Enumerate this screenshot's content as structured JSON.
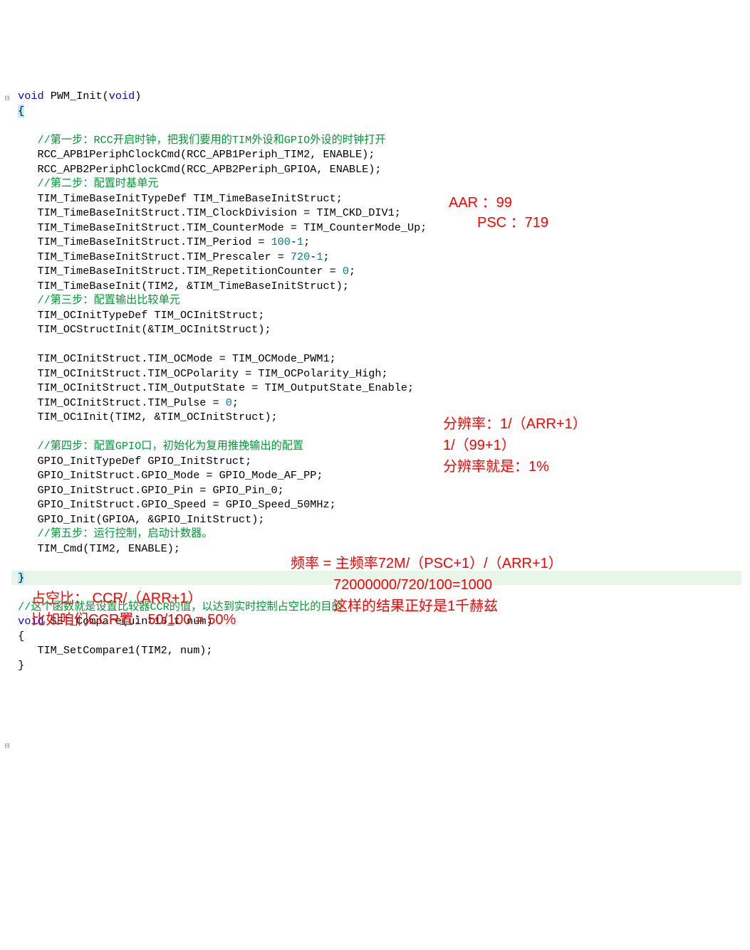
{
  "code": {
    "blank0": " ",
    "sig_void1": "void",
    "sig_fn": " PWM_Init(",
    "sig_void2": "void",
    "sig_close": ")",
    "brace_open": "{",
    "cm1": "//第一步：RCC开启时钟，把我们要用的TIM外设和GPIO外设的时钟打开",
    "line_rcc1": "    RCC_APB1PeriphClockCmd(RCC_APB1Periph_TIM2, ENABLE);",
    "line_rcc2": "    RCC_APB2PeriphClockCmd(RCC_APB2Periph_GPIOA, ENABLE);",
    "cm2": "//第二步：配置时基单元",
    "line_tb1": "    TIM_TimeBaseInitTypeDef TIM_TimeBaseInitStruct;",
    "line_tb2": "    TIM_TimeBaseInitStruct.TIM_ClockDivision = TIM_CKD_DIV1;",
    "line_tb3": "    TIM_TimeBaseInitStruct.TIM_CounterMode = TIM_CounterMode_Up;",
    "line_tb4a": "    TIM_TimeBaseInitStruct.TIM_Period = ",
    "line_tb4n1": "100",
    "line_tb4mid": "-",
    "line_tb4n2": "1",
    "line_tb4b": ";",
    "line_tb5a": "    TIM_TimeBaseInitStruct.TIM_Prescaler = ",
    "line_tb5n1": "720",
    "line_tb5mid": "-",
    "line_tb5n2": "1",
    "line_tb5b": ";",
    "line_tb6a": "    TIM_TimeBaseInitStruct.TIM_RepetitionCounter = ",
    "line_tb6n": "0",
    "line_tb6b": ";",
    "line_tb7": "    TIM_TimeBaseInit(TIM2, &TIM_TimeBaseInitStruct);",
    "cm3": "//第三步：配置输出比较单元",
    "line_oc1": "    TIM_OCInitTypeDef TIM_OCInitStruct;",
    "line_oc2": "    TIM_OCStructInit(&TIM_OCInitStruct);",
    "blank1": "    ",
    "line_oc3": "    TIM_OCInitStruct.TIM_OCMode = TIM_OCMode_PWM1;",
    "line_oc4": "    TIM_OCInitStruct.TIM_OCPolarity = TIM_OCPolarity_High;",
    "line_oc5": "    TIM_OCInitStruct.TIM_OutputState = TIM_OutputState_Enable;",
    "line_oc6a": "    TIM_OCInitStruct.TIM_Pulse = ",
    "line_oc6n": "0",
    "line_oc6b": ";",
    "line_oc7": "    TIM_OC1Init(TIM2, &TIM_OCInitStruct);",
    "blank2": "    ",
    "cm4": "//第四步：配置GPIO口，初始化为复用推挽输出的配置",
    "line_g1": "    GPIO_InitTypeDef GPIO_InitStruct;",
    "line_g2": "    GPIO_InitStruct.GPIO_Mode = GPIO_Mode_AF_PP;",
    "line_g3": "    GPIO_InitStruct.GPIO_Pin = GPIO_Pin_0;",
    "line_g4": "    GPIO_InitStruct.GPIO_Speed = GPIO_Speed_50MHz;",
    "line_g5": "    GPIO_Init(GPIOA, &GPIO_InitStruct);",
    "cm5": "//第五步：运行控制，启动计数器。",
    "line_cmd": "    TIM_Cmd(TIM2, ENABLE);",
    "brace_close_line": "}",
    "blank3": " ",
    "cm6": "//这个函数就是设置比较器CCR的值，以达到实时控制占空比的目的",
    "sig2_void": "void",
    "sig2_rest": " SET_Compare(uint16_t num)",
    "brace2_open": "{",
    "line_set": "    TIM_SetCompare1(TIM2, num);",
    "brace2_close": "}"
  },
  "annotations": {
    "aar": "AAR ：99",
    "psc": "PSC ：719",
    "res1": "分辨率：1/（ARR+1）",
    "res2": "1/（99+1）",
    "res3": "分辨率就是：1%",
    "freq1": "频率 = 主频率72M/（PSC+1）/（ARR+1）",
    "freq2": "72000000/720/100=1000",
    "freq3": "这样的结果正好是1千赫兹",
    "duty1": "占空比： CCR/（ARR+1）",
    "duty2": "比如咱们CCR置：50/100 = 50%"
  },
  "fold": {
    "minus": "⊟"
  }
}
